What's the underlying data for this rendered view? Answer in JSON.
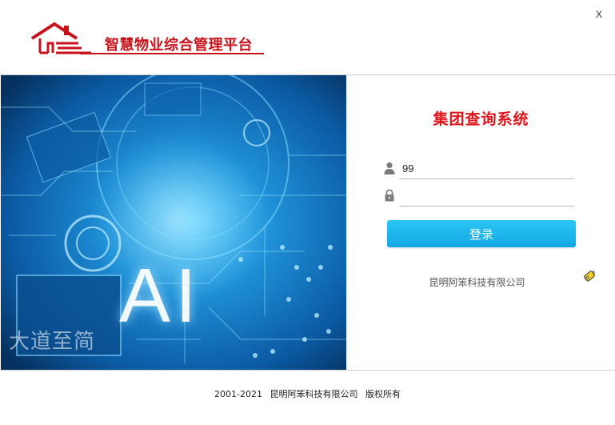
{
  "header": {
    "brand_title": "智慧物业综合管理平台",
    "close_label": "X"
  },
  "banner": {
    "headline": "AI",
    "slogan": "大道至简"
  },
  "login": {
    "system_title": "集团查询系统",
    "username_value": "99",
    "password_value": "",
    "login_button_label": "登录",
    "company_name": "昆明阿笨科技有限公司"
  },
  "footer": {
    "years": "2001-2021",
    "company": "昆明阿笨科技有限公司",
    "rights": "版权所有"
  },
  "colors": {
    "brand_red": "#c8121b",
    "title_red": "#e0151b",
    "button_blue": "#13a7e4",
    "banner_blue": "#0a6ec0"
  },
  "icons": {
    "logo": "house-logo-icon",
    "user": "user-icon",
    "password": "lock-icon",
    "key": "key-icon"
  }
}
